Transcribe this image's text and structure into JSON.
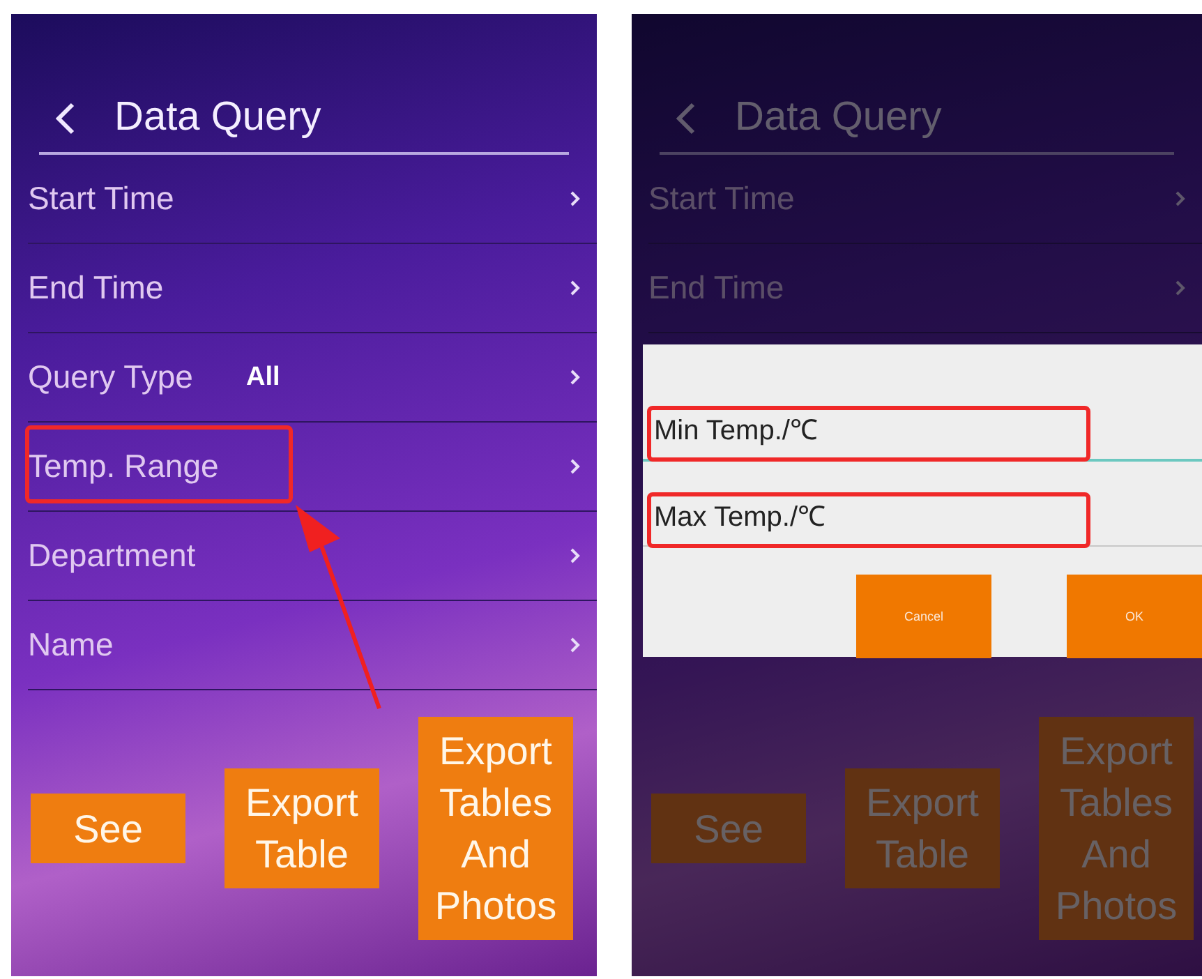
{
  "screens": [
    {
      "title": "Data Query",
      "dimmed": false,
      "rows": [
        {
          "label": "Start Time",
          "highlighted": false
        },
        {
          "label": "End Time",
          "highlighted": false
        },
        {
          "label": "Query Type",
          "value": "All",
          "highlighted": false
        },
        {
          "label": "Temp. Range",
          "highlighted": true
        },
        {
          "label": "Department",
          "highlighted": false
        },
        {
          "label": "Name",
          "highlighted": false
        }
      ],
      "buttons": [
        "See",
        "Export Table",
        "Export Tables And Photos"
      ]
    },
    {
      "title": "Data Query",
      "dimmed": true,
      "rows": [
        {
          "label": "Start Time",
          "highlighted": false
        },
        {
          "label": "End Time",
          "highlighted": false
        }
      ],
      "buttons": [
        "See",
        "Export Table",
        "Export Tables And Photos"
      ],
      "dialog": {
        "fields": [
          {
            "placeholder": "Min Temp./℃",
            "focused": true,
            "highlighted": true
          },
          {
            "placeholder": "Max Temp./℃",
            "focused": false,
            "highlighted": true
          }
        ],
        "buttons": [
          "Cancel",
          "OK"
        ]
      }
    }
  ]
}
